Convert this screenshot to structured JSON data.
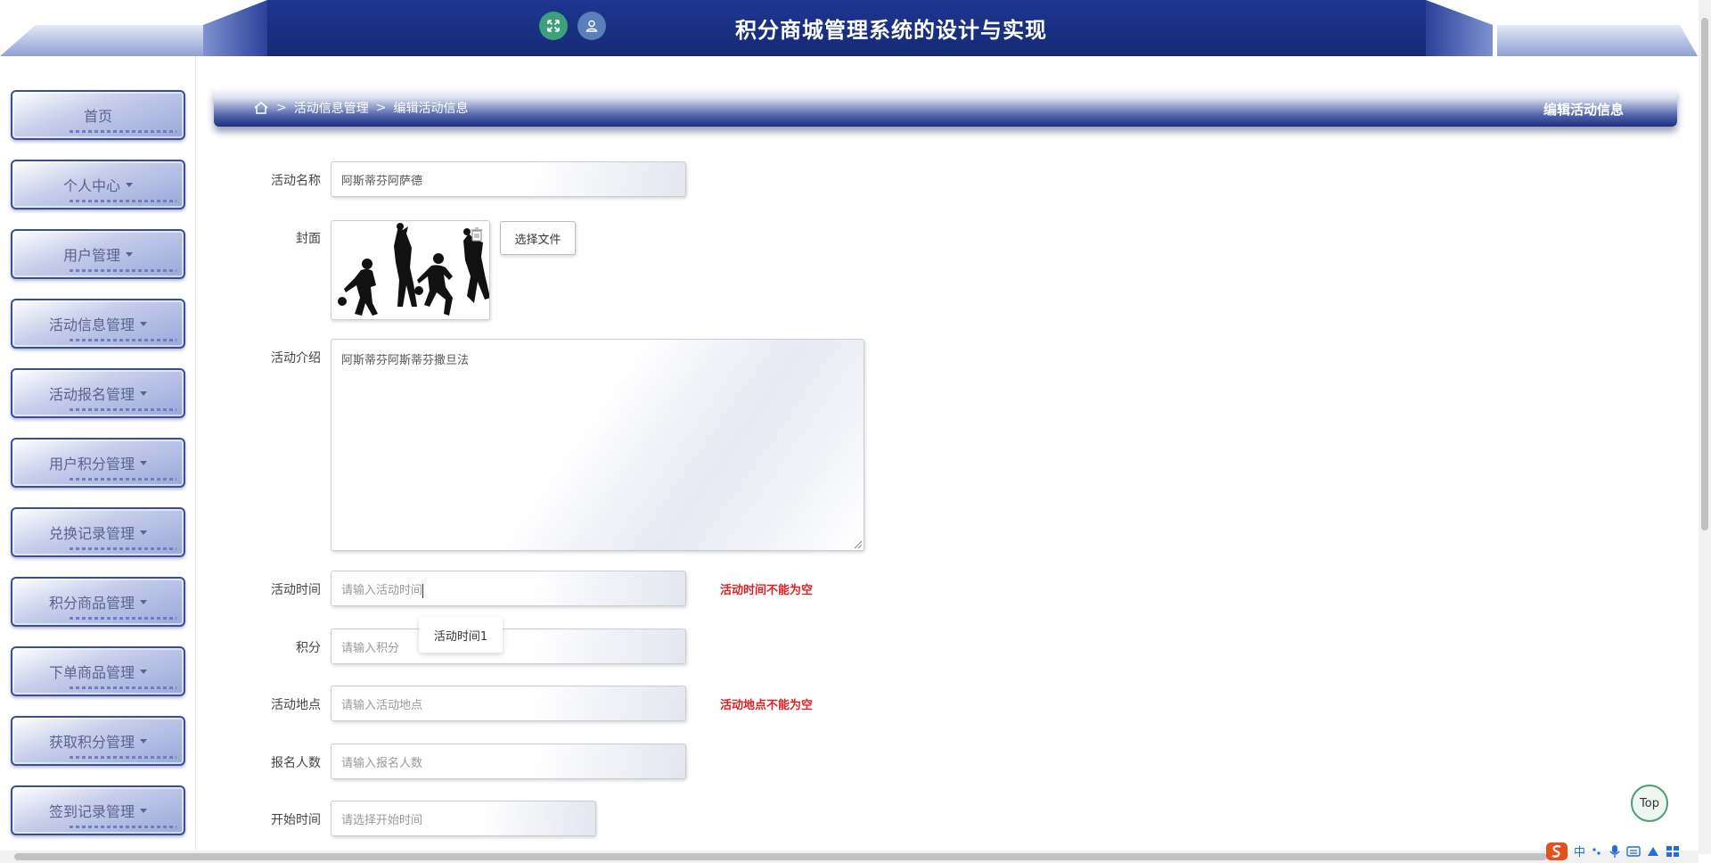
{
  "header": {
    "title": "积分商城管理系统的设计与实现",
    "fullscreen_icon": "fullscreen-icon",
    "user_icon": "user-icon"
  },
  "sidebar": {
    "items": [
      {
        "label": "首页",
        "has_caret": false
      },
      {
        "label": "个人中心",
        "has_caret": true
      },
      {
        "label": "用户管理",
        "has_caret": true
      },
      {
        "label": "活动信息管理",
        "has_caret": true
      },
      {
        "label": "活动报名管理",
        "has_caret": true
      },
      {
        "label": "用户积分管理",
        "has_caret": true
      },
      {
        "label": "兑换记录管理",
        "has_caret": true
      },
      {
        "label": "积分商品管理",
        "has_caret": true
      },
      {
        "label": "下单商品管理",
        "has_caret": true
      },
      {
        "label": "获取积分管理",
        "has_caret": true
      },
      {
        "label": "签到记录管理",
        "has_caret": true
      }
    ]
  },
  "breadcrumb": {
    "sep": ">",
    "level1": "活动信息管理",
    "level2": "编辑活动信息",
    "page_title": "编辑活动信息"
  },
  "form": {
    "name": {
      "label": "活动名称",
      "value": "阿斯蒂芬阿萨德"
    },
    "cover": {
      "label": "封面",
      "file_button": "选择文件"
    },
    "intro": {
      "label": "活动介绍",
      "value": "阿斯蒂芬阿斯蒂芬撒旦法"
    },
    "time": {
      "label": "活动时间",
      "placeholder": "请输入活动时间",
      "error": "活动时间不能为空",
      "suggestion": "活动时间1"
    },
    "points": {
      "label": "积分",
      "placeholder": "请输入积分"
    },
    "location": {
      "label": "活动地点",
      "placeholder": "请输入活动地点",
      "error": "活动地点不能为空"
    },
    "signup_count": {
      "label": "报名人数",
      "placeholder": "请输入报名人数"
    },
    "start_time": {
      "label": "开始时间",
      "placeholder": "请选择开始时间"
    }
  },
  "top_button": "Top",
  "tray": {
    "ime": "中"
  },
  "colors": {
    "header_blue": "#1c2f7e",
    "error_red": "#e02020",
    "accent_green": "#3da07a"
  }
}
